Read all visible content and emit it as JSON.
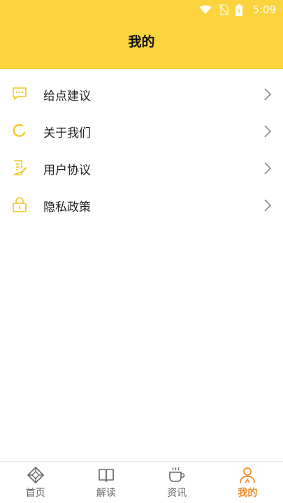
{
  "status_bar": {
    "time": "5:09"
  },
  "header": {
    "title": "我的"
  },
  "menu": {
    "items": [
      {
        "label": "给点建议",
        "icon": "message-icon"
      },
      {
        "label": "关于我们",
        "icon": "circle-icon"
      },
      {
        "label": "用户协议",
        "icon": "document-edit-icon"
      },
      {
        "label": "隐私政策",
        "icon": "lock-icon"
      }
    ]
  },
  "tabbar": {
    "tabs": [
      {
        "label": "首页",
        "icon": "diamond-compass-icon"
      },
      {
        "label": "解读",
        "icon": "book-icon"
      },
      {
        "label": "资讯",
        "icon": "coffee-cup-icon"
      },
      {
        "label": "我的",
        "icon": "user-icon",
        "active": true
      }
    ]
  },
  "colors": {
    "accent_yellow": "#FBD33D",
    "active_orange": "#F08A24",
    "text": "#222222"
  }
}
